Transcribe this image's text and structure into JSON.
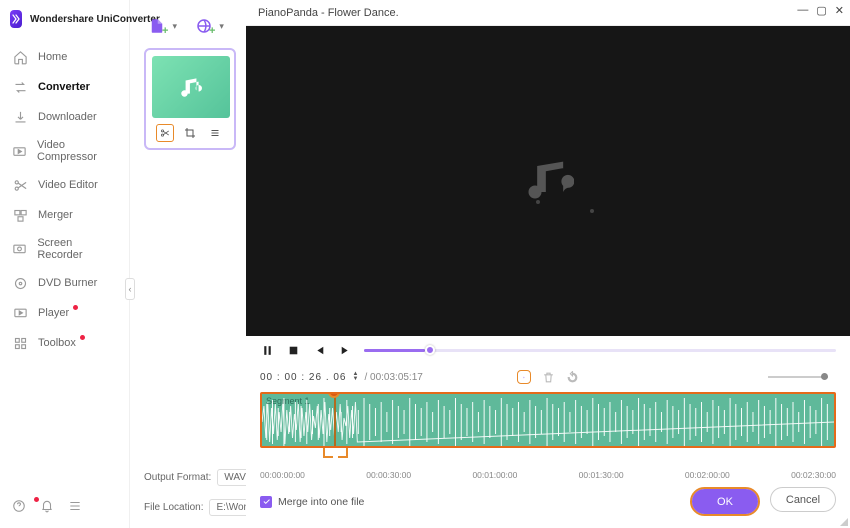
{
  "app": {
    "name": "Wondershare UniConverter"
  },
  "sidebar": {
    "items": [
      {
        "label": "Home"
      },
      {
        "label": "Converter"
      },
      {
        "label": "Downloader"
      },
      {
        "label": "Video Compressor"
      },
      {
        "label": "Video Editor"
      },
      {
        "label": "Merger"
      },
      {
        "label": "Screen Recorder"
      },
      {
        "label": "DVD Burner"
      },
      {
        "label": "Player"
      },
      {
        "label": "Toolbox"
      }
    ]
  },
  "form": {
    "output_label": "Output Format:",
    "output_value": "WAV",
    "location_label": "File Location:",
    "location_value": "E:\\Wondersh"
  },
  "editor": {
    "title": "PianoPanda - Flower Dance.",
    "time_current": "00 : 00 : 26 . 06",
    "time_total": "/ 00:03:05:17",
    "segment_label": "Segment 1",
    "ticks": [
      "00:00:00:00",
      "00:00:30:00",
      "00:01:00:00",
      "00:01:30:00",
      "00:02:00:00",
      "00:02:30:00"
    ],
    "merge_label": "Merge into one file",
    "ok_label": "OK",
    "cancel_label": "Cancel"
  }
}
